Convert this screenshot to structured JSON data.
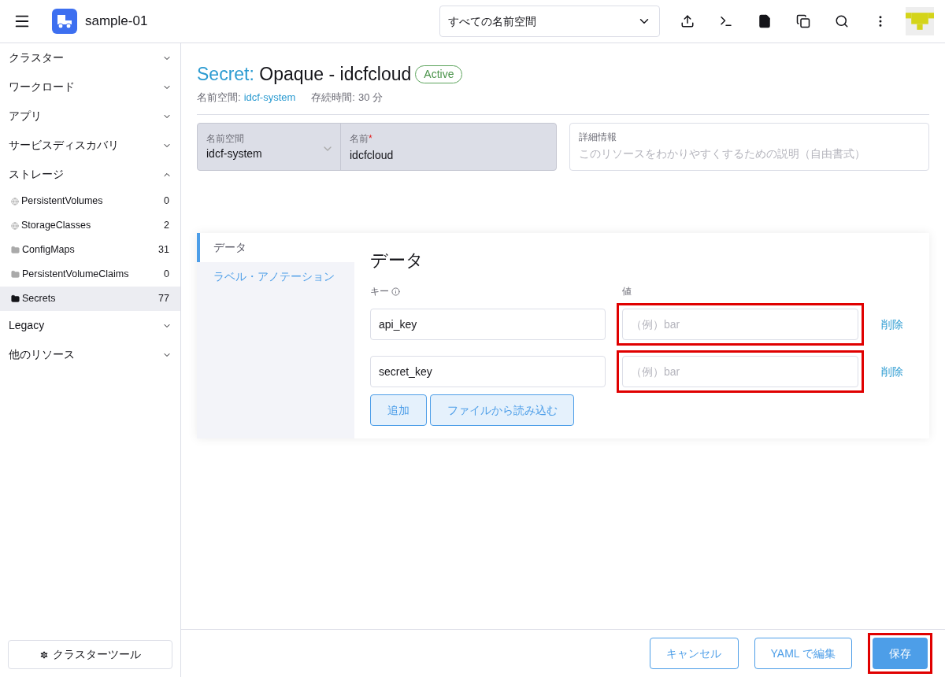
{
  "header": {
    "cluster_name": "sample-01",
    "namespace_select": "すべての名前空間"
  },
  "sidebar": {
    "groups": [
      {
        "label": "クラスター",
        "expanded": false
      },
      {
        "label": "ワークロード",
        "expanded": false
      },
      {
        "label": "アプリ",
        "expanded": false
      },
      {
        "label": "サービスディスカバリ",
        "expanded": false
      },
      {
        "label": "ストレージ",
        "expanded": true,
        "children": [
          {
            "label": "PersistentVolumes",
            "count": "0",
            "kind": "globe",
            "selected": false
          },
          {
            "label": "StorageClasses",
            "count": "2",
            "kind": "globe",
            "selected": false
          },
          {
            "label": "ConfigMaps",
            "count": "31",
            "kind": "folder",
            "selected": false
          },
          {
            "label": "PersistentVolumeClaims",
            "count": "0",
            "kind": "folder",
            "selected": false
          },
          {
            "label": "Secrets",
            "count": "77",
            "kind": "folder",
            "selected": true
          }
        ]
      },
      {
        "label": "Legacy",
        "expanded": false
      },
      {
        "label": "他のリソース",
        "expanded": false
      }
    ],
    "footer_button": "クラスターツール"
  },
  "page": {
    "type_label": "Secret:",
    "title": "Opaque - idcfcloud",
    "status": "Active",
    "meta": [
      {
        "label": "名前空間:",
        "value": "idcf-system",
        "link": true
      },
      {
        "label": "存続時間:",
        "value": "30 分",
        "link": false
      }
    ]
  },
  "form": {
    "namespace": {
      "label": "名前空間",
      "value": "idcf-system"
    },
    "name": {
      "label": "名前",
      "required_mark": "*",
      "value": "idcfcloud"
    },
    "description": {
      "label": "詳細情報",
      "placeholder": "このリソースをわかりやすくするための説明（自由書式）"
    }
  },
  "tabs": [
    {
      "label": "データ",
      "selected": true
    },
    {
      "label": "ラベル・アノテーション",
      "selected": false
    }
  ],
  "data_section": {
    "title": "データ",
    "key_header": "キー",
    "value_header": "値",
    "rows": [
      {
        "key": "api_key",
        "value_placeholder": "（例）bar",
        "remove": "削除",
        "highlighted": true
      },
      {
        "key": "secret_key",
        "value_placeholder": "（例）bar",
        "remove": "削除",
        "highlighted": true
      }
    ],
    "add_button": "追加",
    "file_button": "ファイルから読み込む"
  },
  "footer": {
    "buttons": [
      {
        "label": "キャンセル",
        "kind": "outline",
        "highlighted": false
      },
      {
        "label": "YAML で編集",
        "kind": "outline",
        "highlighted": false
      },
      {
        "label": "保存",
        "kind": "primary",
        "highlighted": true
      }
    ]
  }
}
